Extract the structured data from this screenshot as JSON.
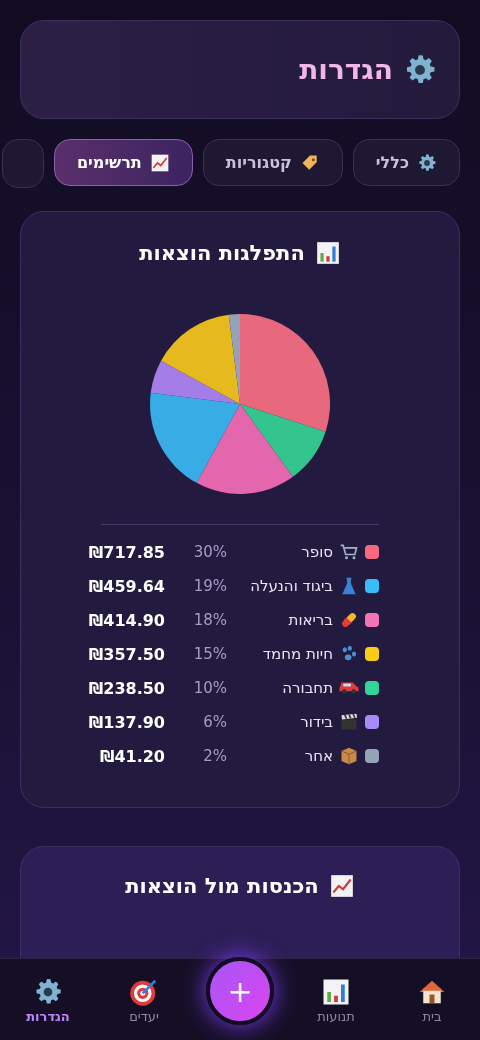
{
  "header": {
    "title": "הגדרות"
  },
  "tabs": [
    {
      "label": "כללי",
      "selected": false
    },
    {
      "label": "קטגוריות",
      "selected": false
    },
    {
      "label": "תרשימים",
      "selected": true
    }
  ],
  "expense_chart": {
    "title": "התפלגות הוצאות",
    "chart_data": {
      "type": "pie",
      "categories": [
        "סופר",
        "תחבורה",
        "בריאות",
        "ביגוד והנעלה",
        "בידור",
        "חיות מחמד",
        "אחר"
      ],
      "values": [
        30,
        10,
        18,
        19,
        6,
        15,
        2
      ],
      "colors": [
        "#e8697d",
        "#34c48e",
        "#e467ad",
        "#38ace4",
        "#a47de8",
        "#e6b91e",
        "#94a3b8"
      ]
    },
    "legend": [
      {
        "percent": "30%",
        "amount": "₪717.85",
        "color": "#f6697f"
      },
      {
        "percent": "19%",
        "amount": "₪459.64",
        "color": "#38bdf8"
      },
      {
        "percent": "18%",
        "amount": "₪414.90",
        "color": "#f472b6"
      },
      {
        "percent": "15%",
        "amount": "₪357.50",
        "color": "#facc15"
      },
      {
        "percent": "10%",
        "amount": "₪238.50",
        "color": "#34d399"
      },
      {
        "percent": "6%",
        "amount": "₪137.90",
        "color": "#a78bfa"
      },
      {
        "percent": "2%",
        "amount": "₪41.20",
        "color": "#94a3b8"
      }
    ]
  },
  "income_chart": {
    "title": "הכנסות מול הוצאות"
  },
  "bottom_nav": [
    {
      "label": "בית",
      "selected": false
    },
    {
      "label": "תנועות",
      "selected": false
    },
    {
      "label": "יעדים",
      "selected": false
    },
    {
      "label": "הגדרות",
      "selected": true
    }
  ],
  "fab": {
    "label": "+"
  }
}
